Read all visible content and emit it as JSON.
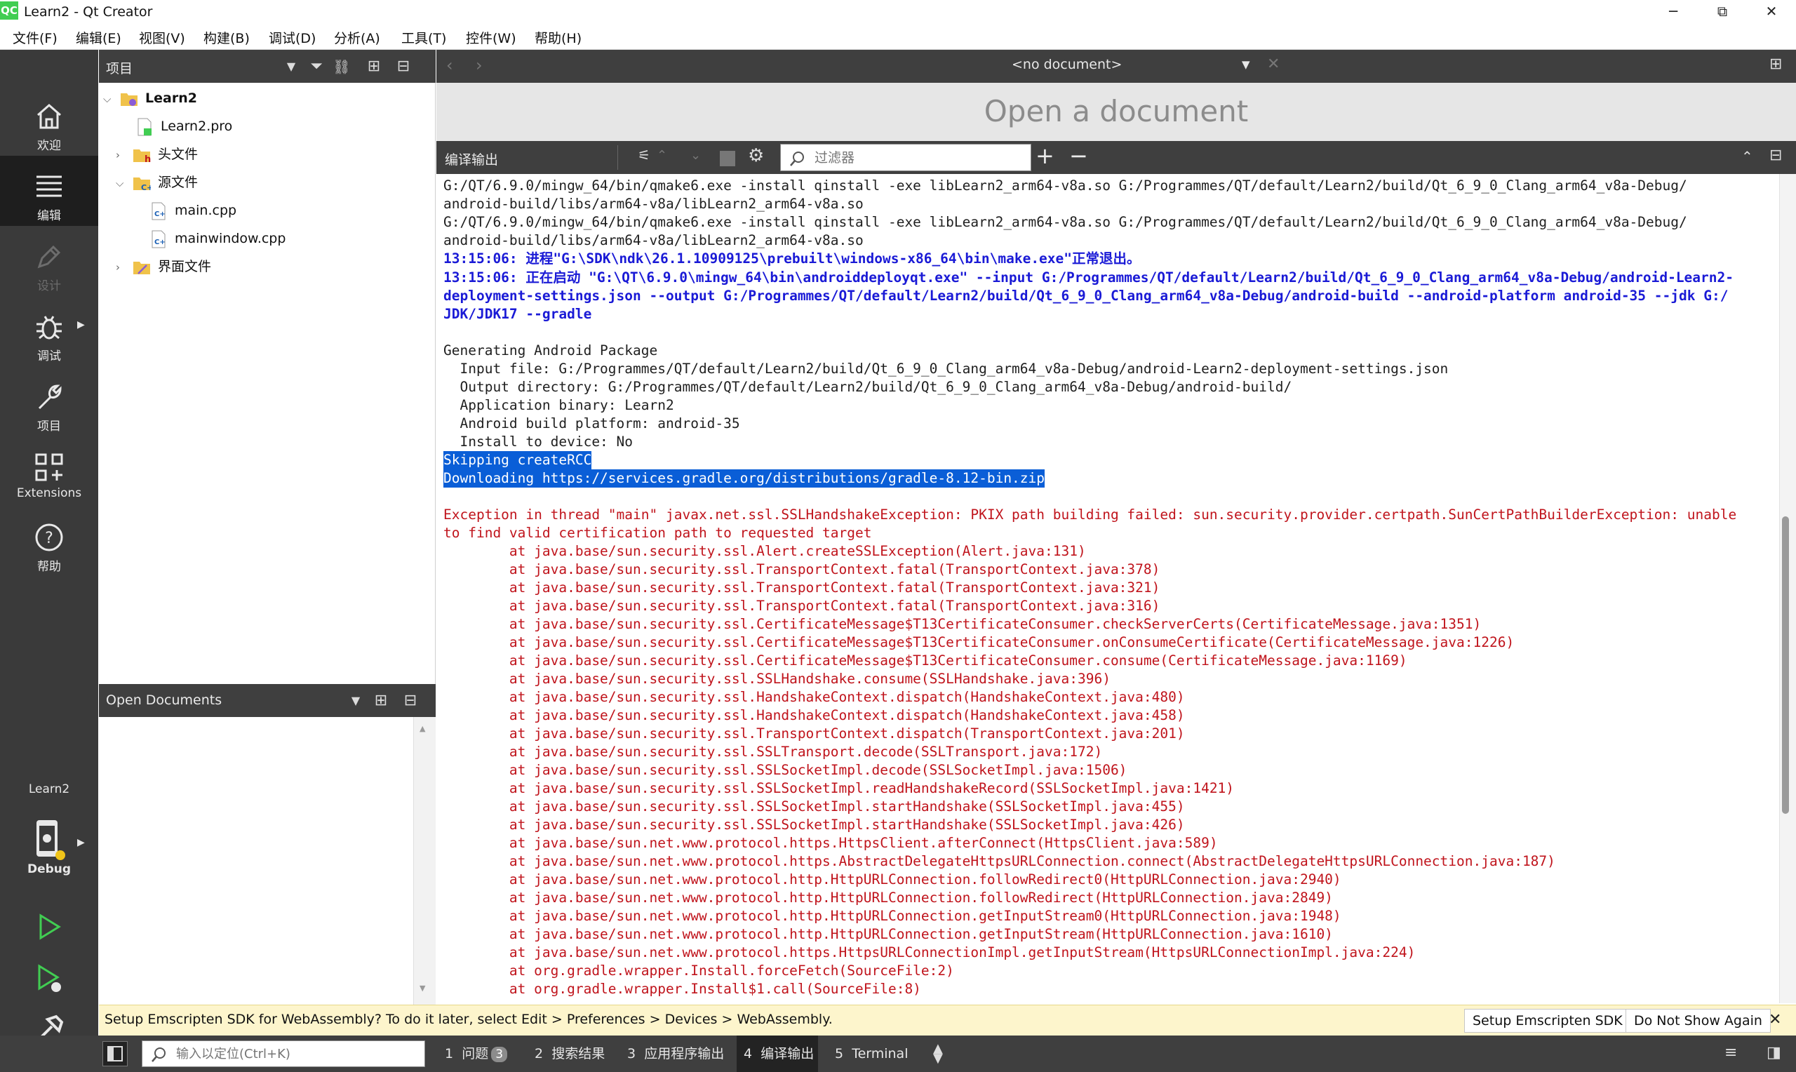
{
  "window": {
    "title": "Learn2 - Qt Creator",
    "app_icon": "QC",
    "minimize": "─",
    "maximize": "⧉",
    "close": "✕"
  },
  "menu": [
    "文件(F)",
    "编辑(E)",
    "视图(V)",
    "构建(B)",
    "调试(D)",
    "分析(A)",
    "工具(T)",
    "控件(W)",
    "帮助(H)"
  ],
  "modes": {
    "welcome": "欢迎",
    "edit": "编辑",
    "design": "设计",
    "debug": "调试",
    "projects": "项目",
    "extensions": "Extensions",
    "help": "帮助"
  },
  "kit": {
    "project": "Learn2",
    "config": "Debug"
  },
  "project_panel": {
    "title": "项目"
  },
  "tree": {
    "root": "Learn2",
    "pro": "Learn2.pro",
    "headers": "头文件",
    "sources": "源文件",
    "main_cpp": "main.cpp",
    "mainwindow_cpp": "mainwindow.cpp",
    "forms": "界面文件"
  },
  "open_docs": {
    "title": "Open Documents"
  },
  "editor": {
    "doc_select": "<no document>",
    "placeholder": "Open a document"
  },
  "output_pane": {
    "title": "编译输出",
    "filter_placeholder": "过滤器",
    "plus": "+",
    "minus": "−"
  },
  "output_lines": {
    "l1": "G:/QT/6.9.0/mingw_64/bin/qmake6.exe -install qinstall -exe libLearn2_arm64-v8a.so G:/Programmes/QT/default/Learn2/build/Qt_6_9_0_Clang_arm64_v8a-Debug/",
    "l2": "android-build/libs/arm64-v8a/libLearn2_arm64-v8a.so",
    "l3": "G:/QT/6.9.0/mingw_64/bin/qmake6.exe -install qinstall -exe libLearn2_arm64-v8a.so G:/Programmes/QT/default/Learn2/build/Qt_6_9_0_Clang_arm64_v8a-Debug/",
    "l4": "android-build/libs/arm64-v8a/libLearn2_arm64-v8a.so",
    "l5": "13:15:06: 进程\"G:\\SDK\\ndk\\26.1.10909125\\prebuilt\\windows-x86_64\\bin\\make.exe\"正常退出。",
    "l6": "13:15:06: 正在启动 \"G:\\QT\\6.9.0\\mingw_64\\bin\\androiddeployqt.exe\" --input G:/Programmes/QT/default/Learn2/build/Qt_6_9_0_Clang_arm64_v8a-Debug/android-Learn2-",
    "l7": "deployment-settings.json --output G:/Programmes/QT/default/Learn2/build/Qt_6_9_0_Clang_arm64_v8a-Debug/android-build --android-platform android-35 --jdk G:/",
    "l8": "JDK/JDK17 --gradle",
    "l9": "Generating Android Package",
    "l10": "  Input file: G:/Programmes/QT/default/Learn2/build/Qt_6_9_0_Clang_arm64_v8a-Debug/android-Learn2-deployment-settings.json",
    "l11": "  Output directory: G:/Programmes/QT/default/Learn2/build/Qt_6_9_0_Clang_arm64_v8a-Debug/android-build/",
    "l12": "  Application binary: Learn2",
    "l13": "  Android build platform: android-35",
    "l14": "  Install to device: No",
    "l15": "Skipping createRCC",
    "l16": "Downloading https://services.gradle.org/distributions/gradle-8.12-bin.zip",
    "l17": "Exception in thread \"main\" javax.net.ssl.SSLHandshakeException: PKIX path building failed: sun.security.provider.certpath.SunCertPathBuilderException: unable",
    "l18": "to find valid certification path to requested target",
    "l19": "\tat java.base/sun.security.ssl.Alert.createSSLException(Alert.java:131)",
    "l20": "\tat java.base/sun.security.ssl.TransportContext.fatal(TransportContext.java:378)",
    "l21": "\tat java.base/sun.security.ssl.TransportContext.fatal(TransportContext.java:321)",
    "l22": "\tat java.base/sun.security.ssl.TransportContext.fatal(TransportContext.java:316)",
    "l23": "\tat java.base/sun.security.ssl.CertificateMessage$T13CertificateConsumer.checkServerCerts(CertificateMessage.java:1351)",
    "l24": "\tat java.base/sun.security.ssl.CertificateMessage$T13CertificateConsumer.onConsumeCertificate(CertificateMessage.java:1226)",
    "l25": "\tat java.base/sun.security.ssl.CertificateMessage$T13CertificateConsumer.consume(CertificateMessage.java:1169)",
    "l26": "\tat java.base/sun.security.ssl.SSLHandshake.consume(SSLHandshake.java:396)",
    "l27": "\tat java.base/sun.security.ssl.HandshakeContext.dispatch(HandshakeContext.java:480)",
    "l28": "\tat java.base/sun.security.ssl.HandshakeContext.dispatch(HandshakeContext.java:458)",
    "l29": "\tat java.base/sun.security.ssl.TransportContext.dispatch(TransportContext.java:201)",
    "l30": "\tat java.base/sun.security.ssl.SSLTransport.decode(SSLTransport.java:172)",
    "l31": "\tat java.base/sun.security.ssl.SSLSocketImpl.decode(SSLSocketImpl.java:1506)",
    "l32": "\tat java.base/sun.security.ssl.SSLSocketImpl.readHandshakeRecord(SSLSocketImpl.java:1421)",
    "l33": "\tat java.base/sun.security.ssl.SSLSocketImpl.startHandshake(SSLSocketImpl.java:455)",
    "l34": "\tat java.base/sun.security.ssl.SSLSocketImpl.startHandshake(SSLSocketImpl.java:426)",
    "l35": "\tat java.base/sun.net.www.protocol.https.HttpsClient.afterConnect(HttpsClient.java:589)",
    "l36": "\tat java.base/sun.net.www.protocol.https.AbstractDelegateHttpsURLConnection.connect(AbstractDelegateHttpsURLConnection.java:187)",
    "l37": "\tat java.base/sun.net.www.protocol.http.HttpURLConnection.followRedirect0(HttpURLConnection.java:2940)",
    "l38": "\tat java.base/sun.net.www.protocol.http.HttpURLConnection.followRedirect(HttpURLConnection.java:2849)",
    "l39": "\tat java.base/sun.net.www.protocol.http.HttpURLConnection.getInputStream0(HttpURLConnection.java:1948)",
    "l40": "\tat java.base/sun.net.www.protocol.http.HttpURLConnection.getInputStream(HttpURLConnection.java:1610)",
    "l41": "\tat java.base/sun.net.www.protocol.https.HttpsURLConnectionImpl.getInputStream(HttpsURLConnectionImpl.java:224)",
    "l42": "\tat org.gradle.wrapper.Install.forceFetch(SourceFile:2)",
    "l43": "\tat org.gradle.wrapper.Install$1.call(SourceFile:8)"
  },
  "infobar": {
    "text": "Setup Emscripten SDK for WebAssembly? To do it later, select Edit > Preferences > Devices > WebAssembly.",
    "setup_button": "Setup Emscripten SDK",
    "dismiss_button": "Do Not Show Again",
    "close": "✕"
  },
  "statusbar": {
    "locator_placeholder": "输入以定位(Ctrl+K)",
    "tabs": [
      {
        "num": "1",
        "label": "问题",
        "badge": "3"
      },
      {
        "num": "2",
        "label": "搜索结果"
      },
      {
        "num": "3",
        "label": "应用程序输出"
      },
      {
        "num": "4",
        "label": "编译输出"
      },
      {
        "num": "5",
        "label": "Terminal"
      }
    ]
  },
  "colors": {
    "error": "#c0141c",
    "info": "#1a1ad6",
    "selection": "#0a5ed7",
    "modebar": "#3a3a3a",
    "infobar": "#fdf5cc"
  }
}
